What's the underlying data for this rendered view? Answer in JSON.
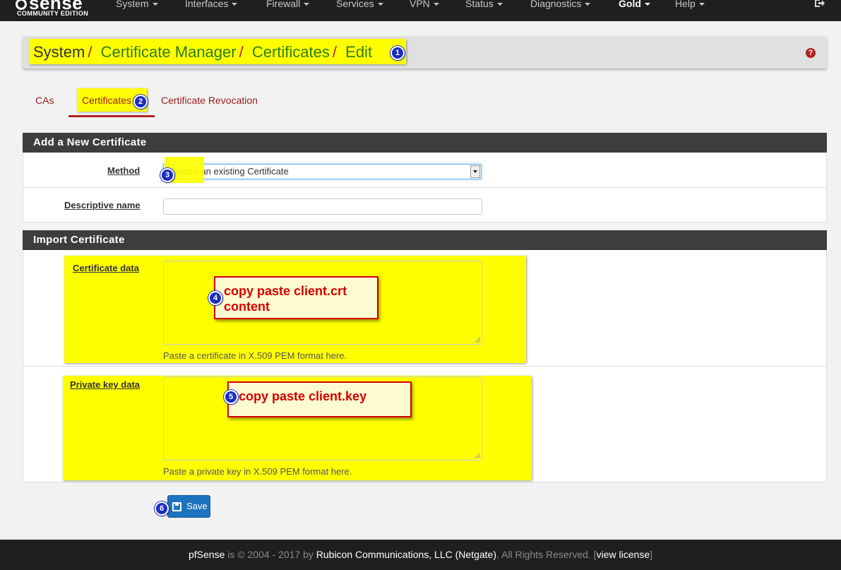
{
  "navbar": {
    "brand_name": "sense",
    "brand_edition": "COMMUNITY EDITION",
    "menus": [
      "System",
      "Interfaces",
      "Firewall",
      "Services",
      "VPN",
      "Status",
      "Diagnostics",
      "Gold",
      "Help"
    ],
    "active_menu": "Gold"
  },
  "breadcrumb": {
    "root": "System",
    "items": [
      "Certificate Manager",
      "Certificates",
      "Edit"
    ],
    "separator": "/"
  },
  "tabs": [
    "CAs",
    "Certificates",
    "Certificate Revocation"
  ],
  "active_tab": "Certificates",
  "panel_new": {
    "title": "Add a New Certificate",
    "method_label": "Method",
    "method_value": "Import an existing Certificate",
    "desc_label": "Descriptive name",
    "desc_value": ""
  },
  "panel_import": {
    "title": "Import Certificate",
    "cert_label": "Certificate data",
    "cert_help": "Paste a certificate in X.509 PEM format here.",
    "key_label": "Private key data",
    "key_help": "Paste a private key in X.509 PEM format here."
  },
  "annotations": {
    "b1": "1",
    "b2": "2",
    "b3": "3",
    "b4": "4",
    "b5": "5",
    "b6": "6",
    "callout_cert": "copy paste client.crt content",
    "callout_key": "copy paste client.key"
  },
  "save_label": "Save",
  "footer": {
    "product": "pfSense",
    "is_text": "is © 2004 - 2017 by",
    "company": "Rubicon Communications, LLC (Netgate)",
    "rights": ". All Rights Reserved. [",
    "license_link": "view license",
    "close": "]"
  },
  "colors": {
    "highlight": "#ffff00",
    "nav_bg": "#1f1f1f",
    "panel_head": "#3d3d3d",
    "link_red": "#9c1b1b",
    "crumb_green": "#2e7d14",
    "badge_blue": "#1a2ec0",
    "save_blue": "#1e73be"
  },
  "icons": [
    "logout-icon",
    "help-icon",
    "select-caret-icon",
    "save-icon",
    "resize-grip-icon"
  ]
}
